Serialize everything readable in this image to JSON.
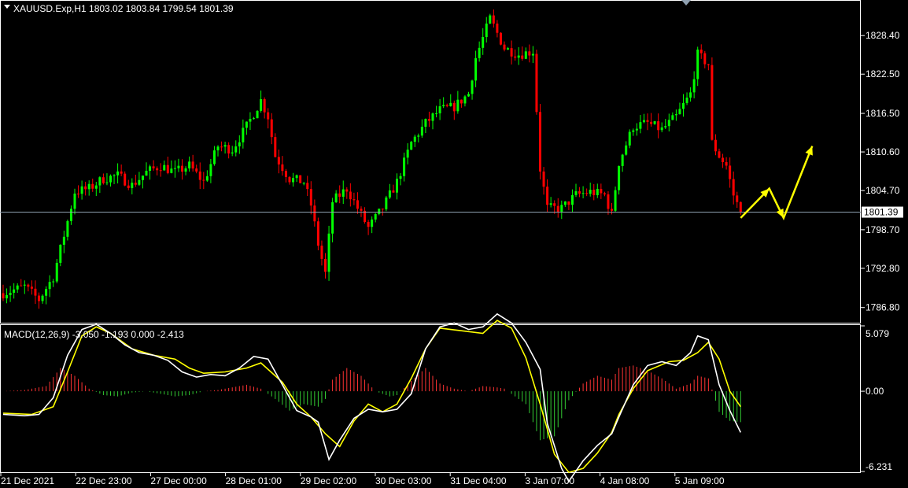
{
  "header": {
    "symbol_line": "XAUUSD.Exp,H1  1803.02 1803.84 1799.54 1801.39",
    "macd_line": "MACD(12,26,9) -3.050 -1.193 0.000 -2.413"
  },
  "colors": {
    "background": "#000000",
    "grid_border": "#ffffff",
    "bull_candle": "#00ff00",
    "bear_candle": "#ff0000",
    "macd_main": "#ffffff",
    "macd_signal": "#ffff00",
    "hist_positive": "#ff3333",
    "hist_negative": "#33cc33",
    "projection": "#ffff00",
    "current_price_line": "#8fa0b0"
  },
  "chart_data": [
    {
      "type": "candlestick",
      "title": "XAUUSD.Exp,H1",
      "price_axis_ticks": [
        "1828.40",
        "1822.50",
        "1816.50",
        "1810.60",
        "1804.70",
        "1798.70",
        "1792.80",
        "1786.80"
      ],
      "ylim": [
        1784.6,
        1833.6
      ],
      "current_price": "1801.39",
      "time_axis_labels": [
        "21 Dec 2021",
        "22 Dec 23:00",
        "27 Dec 00:00",
        "28 Dec 01:00",
        "29 Dec 02:00",
        "30 Dec 03:00",
        "31 Dec 04:00",
        "3 Jan 07:00",
        "4 Jan 08:00",
        "5 Jan 09:00"
      ],
      "close_path": [
        [
          0,
          1789.0
        ],
        [
          6,
          1790.0
        ],
        [
          10,
          1788.0
        ],
        [
          14,
          1791.5
        ],
        [
          18,
          1800.0
        ],
        [
          20,
          1804.5
        ],
        [
          24,
          1805.0
        ],
        [
          28,
          1806.5
        ],
        [
          32,
          1807.0
        ],
        [
          36,
          1805.5
        ],
        [
          40,
          1807.5
        ],
        [
          44,
          1808.5
        ],
        [
          48,
          1807.5
        ],
        [
          52,
          1808.5
        ],
        [
          56,
          1806.0
        ],
        [
          60,
          1811.5
        ],
        [
          64,
          1811.0
        ],
        [
          68,
          1814.5
        ],
        [
          72,
          1818.5
        ],
        [
          74,
          1816.0
        ],
        [
          76,
          1810.0
        ],
        [
          80,
          1806.5
        ],
        [
          84,
          1806.0
        ],
        [
          86,
          1802.5
        ],
        [
          88,
          1796.5
        ],
        [
          90,
          1792.0
        ],
        [
          92,
          1803.0
        ],
        [
          96,
          1805.0
        ],
        [
          100,
          1801.0
        ],
        [
          102,
          1799.0
        ],
        [
          106,
          1802.0
        ],
        [
          110,
          1806.0
        ],
        [
          114,
          1812.0
        ],
        [
          118,
          1815.0
        ],
        [
          122,
          1817.0
        ],
        [
          126,
          1817.5
        ],
        [
          130,
          1819.5
        ],
        [
          132,
          1825.0
        ],
        [
          136,
          1831.0
        ],
        [
          140,
          1826.5
        ],
        [
          144,
          1825.5
        ],
        [
          148,
          1826.0
        ],
        [
          150,
          1808.0
        ],
        [
          152,
          1802.0
        ],
        [
          156,
          1802.0
        ],
        [
          160,
          1804.0
        ],
        [
          164,
          1804.5
        ],
        [
          168,
          1804.0
        ],
        [
          170,
          1801.0
        ],
        [
          172,
          1809.0
        ],
        [
          176,
          1814.5
        ],
        [
          180,
          1815.0
        ],
        [
          184,
          1814.0
        ],
        [
          188,
          1816.0
        ],
        [
          192,
          1819.5
        ],
        [
          194,
          1825.5
        ],
        [
          197,
          1824.0
        ],
        [
          198,
          1812.0
        ],
        [
          200,
          1810.0
        ],
        [
          202,
          1808.5
        ],
        [
          204,
          1804.0
        ],
        [
          206,
          1801.4
        ]
      ],
      "projection_arrow": [
        [
          206,
          1800.5
        ],
        [
          214,
          1805.0
        ],
        [
          218,
          1800.5
        ],
        [
          226,
          1811.5
        ]
      ]
    },
    {
      "type": "line",
      "title": "MACD(12,26,9)",
      "axis_ticks": [
        "5.079",
        "0.00",
        "-6.231"
      ],
      "ylim": [
        -6.231,
        5.079
      ],
      "series": [
        {
          "name": "MACD",
          "values": [
            [
              0,
              -1.8
            ],
            [
              6,
              -1.9
            ],
            [
              10,
              -1.8
            ],
            [
              14,
              -0.5
            ],
            [
              18,
              2.8
            ],
            [
              22,
              4.8
            ],
            [
              26,
              5.2
            ],
            [
              30,
              4.5
            ],
            [
              34,
              3.6
            ],
            [
              38,
              3.0
            ],
            [
              42,
              2.8
            ],
            [
              46,
              2.4
            ],
            [
              50,
              1.5
            ],
            [
              54,
              1.1
            ],
            [
              58,
              1.3
            ],
            [
              62,
              1.2
            ],
            [
              66,
              1.8
            ],
            [
              70,
              2.7
            ],
            [
              74,
              2.5
            ],
            [
              78,
              0.5
            ],
            [
              82,
              -1.5
            ],
            [
              86,
              -2.0
            ],
            [
              88,
              -2.4
            ],
            [
              91,
              -5.3
            ],
            [
              94,
              -3.8
            ],
            [
              98,
              -2.1
            ],
            [
              102,
              -1.4
            ],
            [
              106,
              -1.6
            ],
            [
              110,
              -1.4
            ],
            [
              114,
              -0.2
            ],
            [
              118,
              3.3
            ],
            [
              122,
              5.0
            ],
            [
              126,
              5.3
            ],
            [
              130,
              4.8
            ],
            [
              134,
              5.0
            ],
            [
              138,
              6.0
            ],
            [
              142,
              5.3
            ],
            [
              146,
              3.8
            ],
            [
              150,
              1.7
            ],
            [
              152,
              -2.5
            ],
            [
              156,
              -6.0
            ],
            [
              158,
              -7.0
            ],
            [
              162,
              -5.4
            ],
            [
              166,
              -4.2
            ],
            [
              170,
              -3.3
            ],
            [
              172,
              -2.0
            ],
            [
              176,
              0.5
            ],
            [
              180,
              2.0
            ],
            [
              184,
              2.3
            ],
            [
              188,
              2.0
            ],
            [
              192,
              3.0
            ],
            [
              194,
              4.3
            ],
            [
              197,
              4.0
            ],
            [
              200,
              0.5
            ],
            [
              203,
              -1.5
            ],
            [
              206,
              -3.2
            ]
          ]
        },
        {
          "name": "Signal",
          "values": [
            [
              0,
              -1.7
            ],
            [
              8,
              -1.8
            ],
            [
              14,
              -1.2
            ],
            [
              18,
              1.5
            ],
            [
              22,
              4.3
            ],
            [
              26,
              5.0
            ],
            [
              30,
              4.5
            ],
            [
              36,
              3.3
            ],
            [
              42,
              2.8
            ],
            [
              48,
              2.5
            ],
            [
              52,
              1.8
            ],
            [
              56,
              1.4
            ],
            [
              62,
              1.5
            ],
            [
              68,
              1.8
            ],
            [
              72,
              2.2
            ],
            [
              78,
              0.7
            ],
            [
              82,
              -1.0
            ],
            [
              86,
              -2.0
            ],
            [
              90,
              -3.3
            ],
            [
              94,
              -4.3
            ],
            [
              98,
              -2.3
            ],
            [
              102,
              -1.0
            ],
            [
              106,
              -1.6
            ],
            [
              110,
              -1.0
            ],
            [
              114,
              1.0
            ],
            [
              118,
              3.3
            ],
            [
              122,
              4.9
            ],
            [
              128,
              4.7
            ],
            [
              134,
              4.5
            ],
            [
              138,
              5.5
            ],
            [
              142,
              4.9
            ],
            [
              146,
              2.6
            ],
            [
              150,
              -1.0
            ],
            [
              154,
              -4.9
            ],
            [
              158,
              -6.3
            ],
            [
              162,
              -6.0
            ],
            [
              166,
              -4.8
            ],
            [
              170,
              -3.2
            ],
            [
              172,
              -1.8
            ],
            [
              176,
              0.2
            ],
            [
              180,
              1.6
            ],
            [
              186,
              2.3
            ],
            [
              190,
              2.4
            ],
            [
              194,
              3.0
            ],
            [
              197,
              3.8
            ],
            [
              200,
              2.5
            ],
            [
              203,
              0.0
            ],
            [
              206,
              -1.2
            ]
          ]
        },
        {
          "name": "Histogram",
          "values": [
            [
              0,
              0.0
            ],
            [
              6,
              0.1
            ],
            [
              12,
              0.4
            ],
            [
              16,
              1.8
            ],
            [
              20,
              1.2
            ],
            [
              24,
              0.2
            ],
            [
              28,
              -0.3
            ],
            [
              32,
              -0.4
            ],
            [
              36,
              -0.1
            ],
            [
              40,
              0.0
            ],
            [
              44,
              -0.2
            ],
            [
              48,
              -0.4
            ],
            [
              52,
              -0.3
            ],
            [
              56,
              0.0
            ],
            [
              60,
              0.1
            ],
            [
              64,
              0.3
            ],
            [
              68,
              0.5
            ],
            [
              72,
              0.2
            ],
            [
              76,
              -0.6
            ],
            [
              80,
              -1.5
            ],
            [
              84,
              -1.0
            ],
            [
              88,
              -1.2
            ],
            [
              90,
              -0.6
            ],
            [
              92,
              0.9
            ],
            [
              96,
              1.8
            ],
            [
              100,
              1.2
            ],
            [
              104,
              0.0
            ],
            [
              108,
              -0.4
            ],
            [
              110,
              -0.3
            ],
            [
              114,
              0.8
            ],
            [
              118,
              1.8
            ],
            [
              122,
              0.6
            ],
            [
              126,
              0.2
            ],
            [
              130,
              0.0
            ],
            [
              134,
              0.4
            ],
            [
              138,
              0.3
            ],
            [
              140,
              0.2
            ],
            [
              142,
              -0.2
            ],
            [
              146,
              -1.0
            ],
            [
              150,
              -3.8
            ],
            [
              154,
              -3.5
            ],
            [
              158,
              -0.7
            ],
            [
              162,
              0.6
            ],
            [
              166,
              1.2
            ],
            [
              170,
              0.9
            ],
            [
              172,
              1.8
            ],
            [
              176,
              2.0
            ],
            [
              180,
              1.6
            ],
            [
              184,
              1.0
            ],
            [
              188,
              0.2
            ],
            [
              192,
              0.6
            ],
            [
              194,
              1.2
            ],
            [
              197,
              1.0
            ],
            [
              200,
              -1.6
            ],
            [
              203,
              -2.3
            ],
            [
              206,
              -2.4
            ]
          ]
        }
      ]
    }
  ]
}
